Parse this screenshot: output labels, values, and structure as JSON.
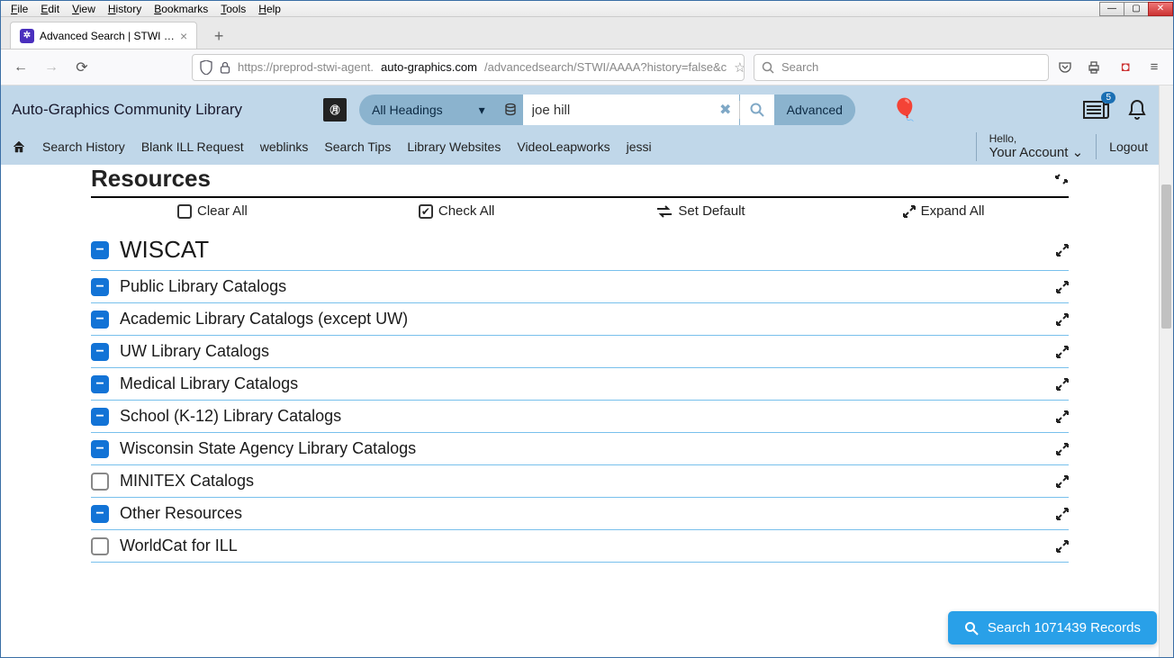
{
  "menu": [
    "File",
    "Edit",
    "View",
    "History",
    "Bookmarks",
    "Tools",
    "Help"
  ],
  "tab": {
    "title": "Advanced Search | STWI | AAAA"
  },
  "url": {
    "pre": "https://preprod-stwi-agent.",
    "domain": "auto-graphics.com",
    "path": "/advancedsearch/STWI/AAAA?history=false&c"
  },
  "browser_search_placeholder": "Search",
  "library_name": "Auto-Graphics Community Library",
  "search": {
    "dropdown": "All Headings",
    "value": "joe hill",
    "advanced": "Advanced"
  },
  "badge_count": "5",
  "nav_links": [
    "Search History",
    "Blank ILL Request",
    "weblinks",
    "Search Tips",
    "Library Websites",
    "VideoLeapworks",
    "jessi"
  ],
  "account": {
    "hello": "Hello,",
    "your_account": "Your Account",
    "logout": "Logout"
  },
  "resources_title": "Resources",
  "actions": {
    "clear": "Clear All",
    "check": "Check All",
    "default": "Set Default",
    "expand": "Expand All"
  },
  "main_group": "WISCAT",
  "rows": [
    {
      "label": "Public Library Catalogs",
      "state": "minus"
    },
    {
      "label": "Academic Library Catalogs (except UW)",
      "state": "minus"
    },
    {
      "label": "UW Library Catalogs",
      "state": "minus"
    },
    {
      "label": "Medical Library Catalogs",
      "state": "minus"
    },
    {
      "label": "School (K-12) Library Catalogs",
      "state": "minus"
    },
    {
      "label": "Wisconsin State Agency Library Catalogs",
      "state": "minus"
    },
    {
      "label": "MINITEX Catalogs",
      "state": "empty"
    },
    {
      "label": "Other Resources",
      "state": "minus"
    },
    {
      "label": "WorldCat for ILL",
      "state": "empty"
    }
  ],
  "float_button": "Search 1071439 Records"
}
